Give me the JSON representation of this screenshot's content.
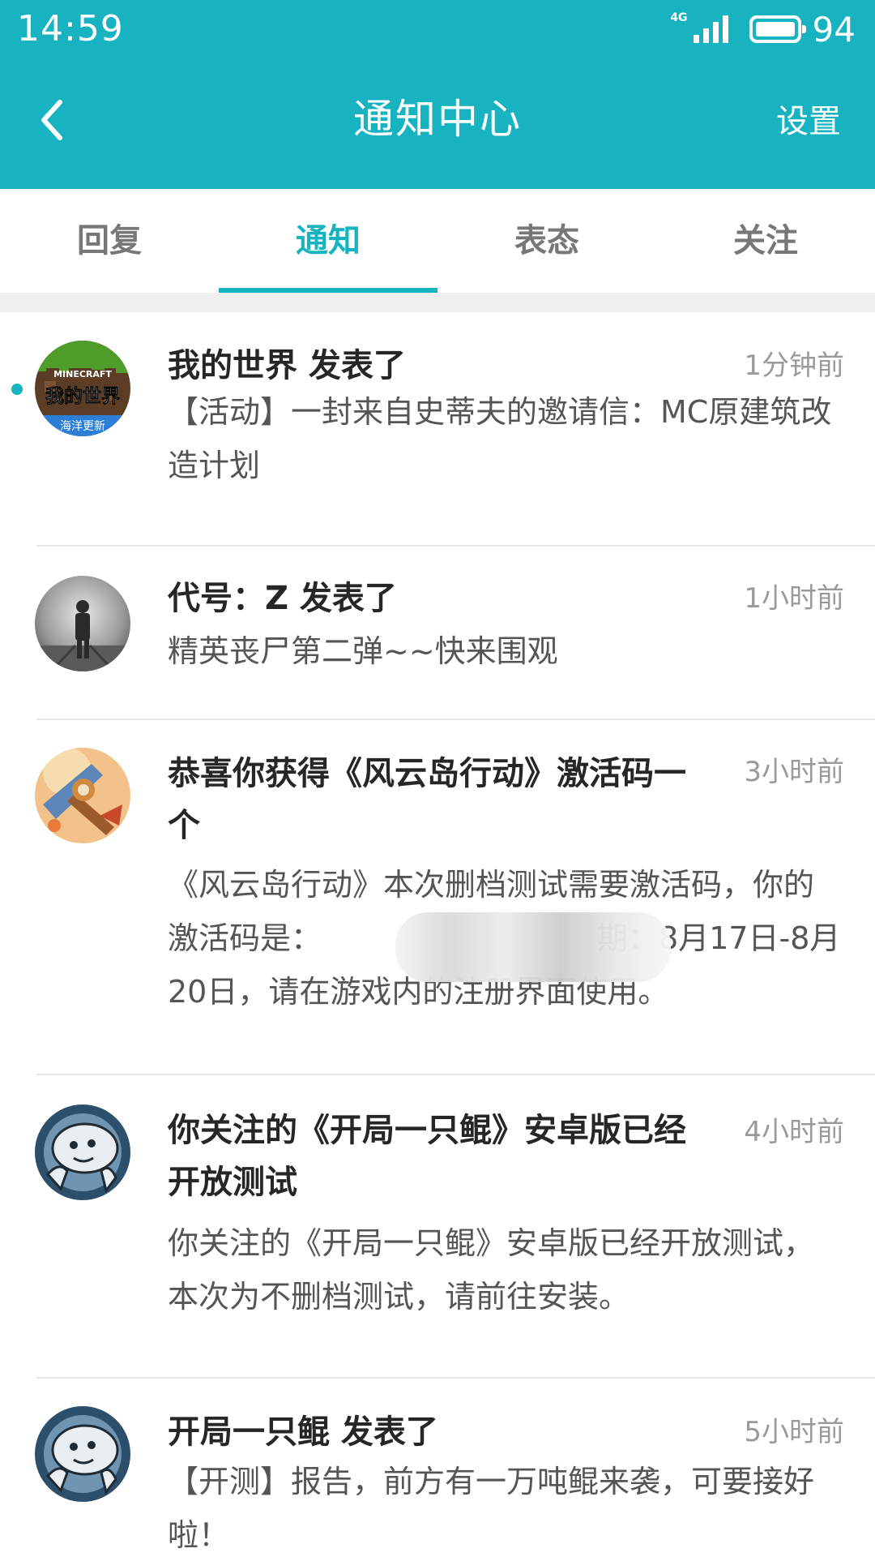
{
  "status_bar": {
    "time": "14:59",
    "network": "4G",
    "battery": "94"
  },
  "header": {
    "back_icon": "chevron-left-icon",
    "title": "通知中心",
    "settings": "设置"
  },
  "tabs": [
    {
      "label": "回复",
      "active": false
    },
    {
      "label": "通知",
      "active": true
    },
    {
      "label": "表态",
      "active": false
    },
    {
      "label": "关注",
      "active": false
    }
  ],
  "notifications": [
    {
      "title": "我的世界 发表了",
      "time": "1分钟前",
      "body": "【活动】一封来自史蒂夫的邀请信：MC原建筑改造计划",
      "unread": true,
      "avatar_icon": "minecraft-avatar",
      "avatar_text": "我的世界",
      "avatar_subtext": "海洋更新"
    },
    {
      "title": "代号：Z 发表了",
      "time": "1小时前",
      "body": "精英丧尸第二弹~~快来围观",
      "unread": false,
      "avatar_icon": "zombie-game-avatar"
    },
    {
      "title": "恭喜你获得《风云岛行动》激活码一个",
      "time": "3小时前",
      "body": "《风云岛行动》本次删档测试需要激活码，你的激活码是：",
      "body_suffix": "期：8月17日-8月20日，请在游戏内的注册界面使用。",
      "unread": false,
      "avatar_icon": "fengyun-island-avatar"
    },
    {
      "title": "你关注的《开局一只鲲》安卓版已经开放测试",
      "time": "4小时前",
      "body": "你关注的《开局一只鲲》安卓版已经开放测试，本次为不删档测试，请前往安装。",
      "unread": false,
      "avatar_icon": "kun-game-avatar"
    },
    {
      "title": "开局一只鲲 发表了",
      "time": "5小时前",
      "body": "【开测】报告，前方有一万吨鲲来袭，可要接好啦！",
      "unread": false,
      "avatar_icon": "kun-game-avatar"
    }
  ],
  "colors": {
    "accent": "#17b3c1",
    "title_text": "#262626",
    "body_text": "#555555",
    "time_text": "#9a9a9a"
  }
}
